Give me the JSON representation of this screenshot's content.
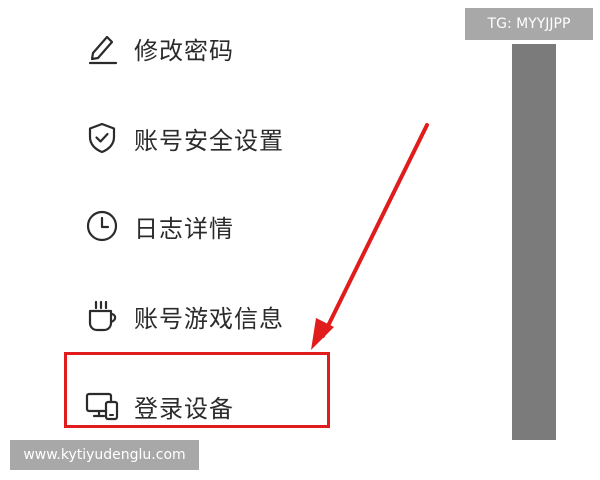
{
  "menu": {
    "items": [
      {
        "label": "修改密码",
        "icon": "pencil-icon"
      },
      {
        "label": "账号安全设置",
        "icon": "shield-check-icon"
      },
      {
        "label": "日志详情",
        "icon": "clock-icon"
      },
      {
        "label": "账号游戏信息",
        "icon": "cup-icon"
      },
      {
        "label": "登录设备",
        "icon": "devices-icon"
      }
    ]
  },
  "annotation": {
    "highlight_color": "#e01c1c",
    "highlighted_item": "登录设备"
  },
  "overlay": {
    "tag": "TG: MYYJJPP",
    "watermark": "www.kytiyudenglu.com"
  },
  "colors": {
    "text": "#2b2b2b",
    "scrollbar": "#7b7b7b",
    "badge_bg": "#a8a8a8"
  }
}
